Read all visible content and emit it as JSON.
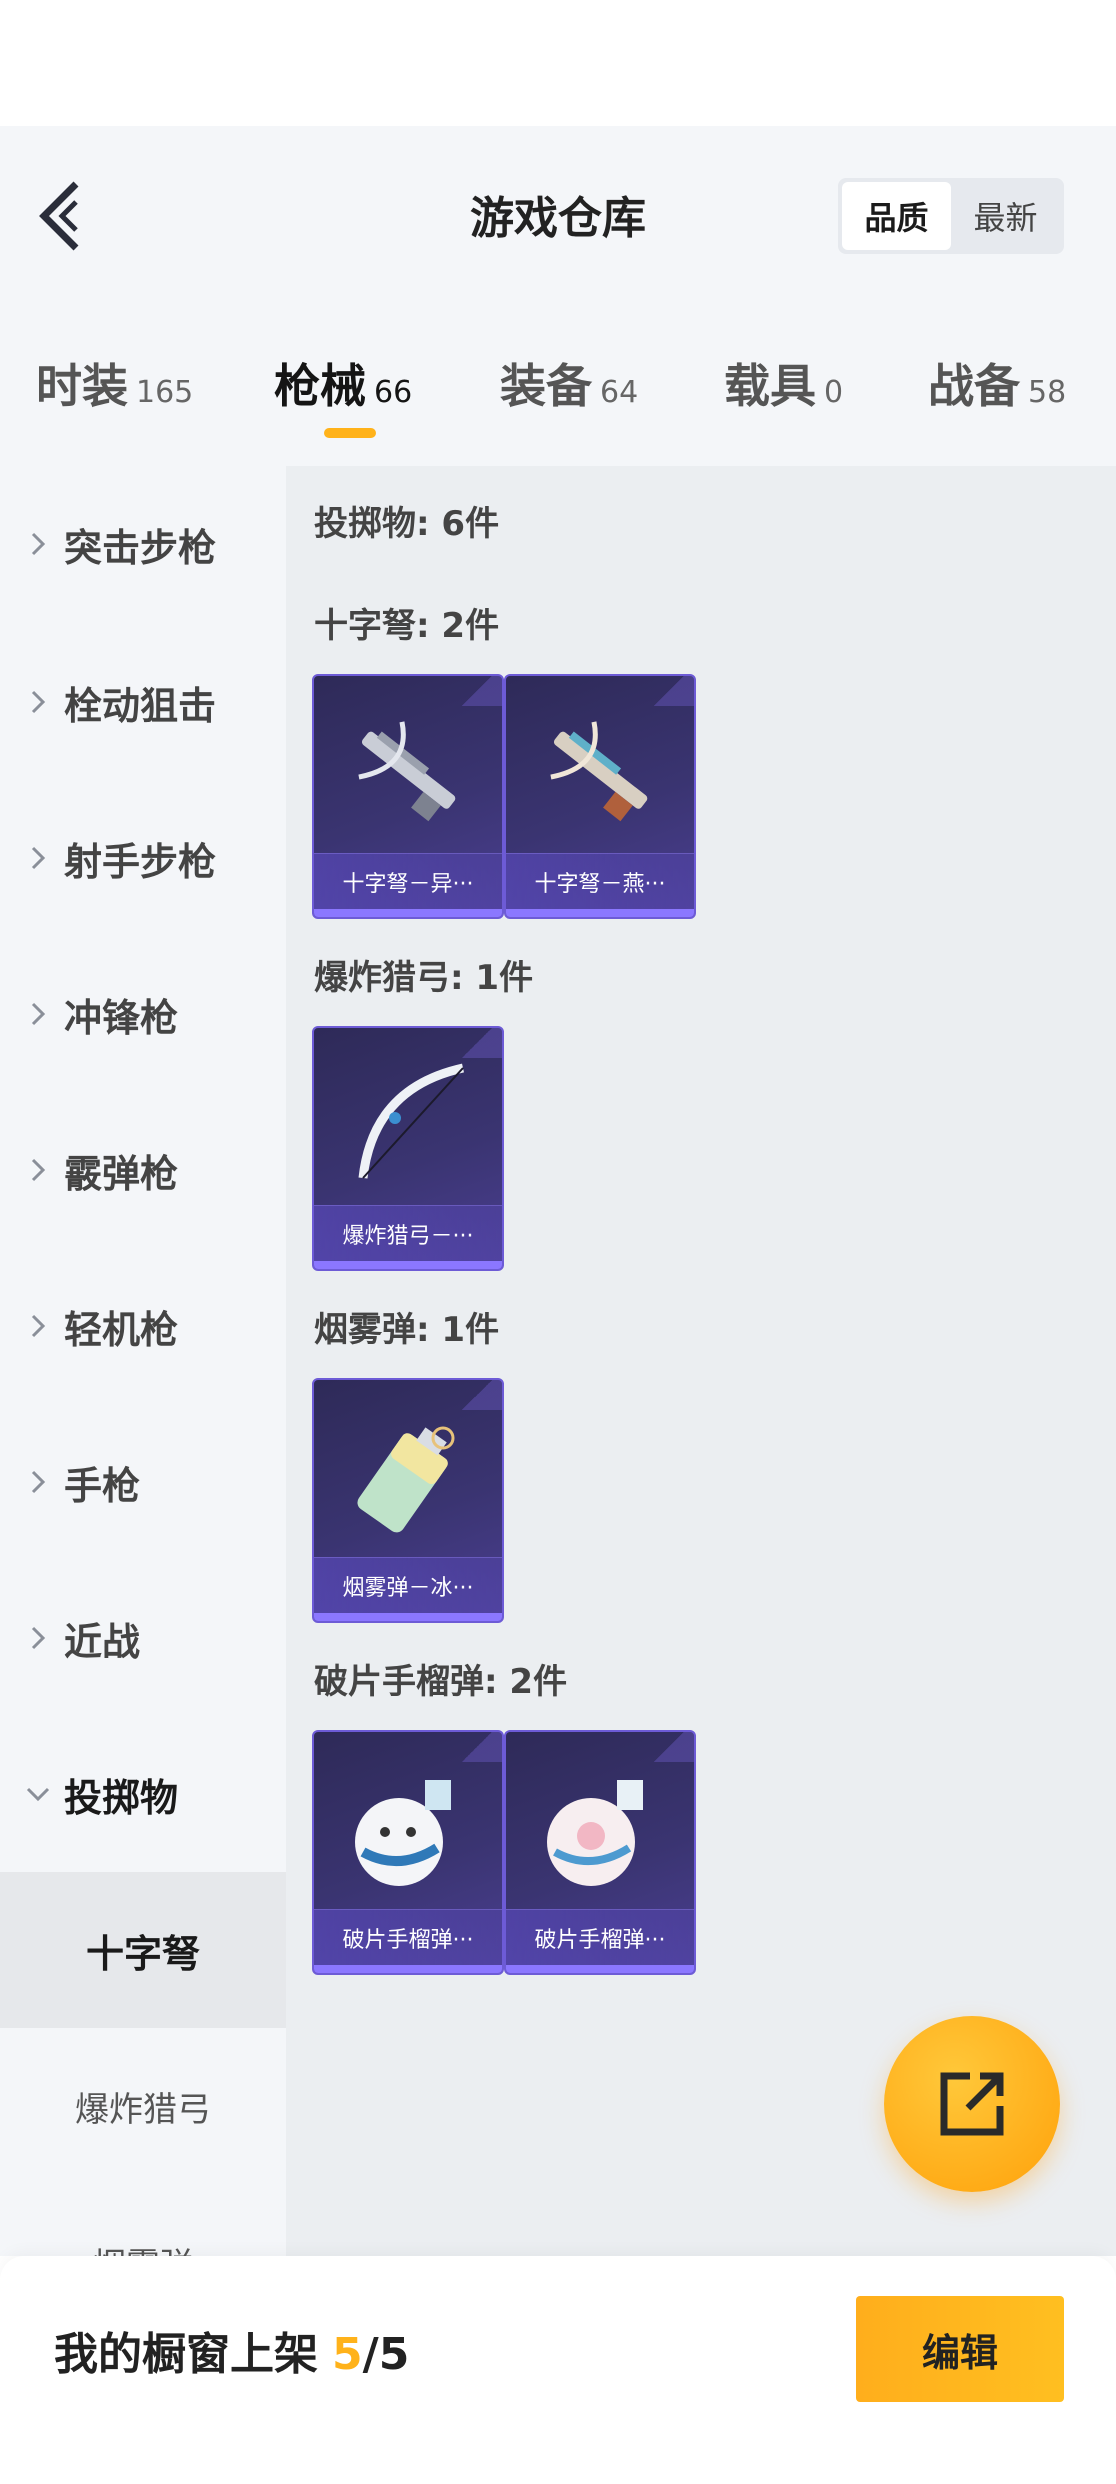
{
  "header": {
    "title": "游戏仓库",
    "sort": {
      "options": [
        "品质",
        "最新"
      ],
      "selected": "品质"
    }
  },
  "tabs": [
    {
      "label": "时装",
      "count": "165"
    },
    {
      "label": "枪械",
      "count": "66",
      "active": true
    },
    {
      "label": "装备",
      "count": "64"
    },
    {
      "label": "载具",
      "count": "0"
    },
    {
      "label": "战备",
      "count": "58"
    }
  ],
  "sidebar": {
    "categories": [
      {
        "label": "突击步枪"
      },
      {
        "label": "栓动狙击"
      },
      {
        "label": "射手步枪"
      },
      {
        "label": "冲锋枪"
      },
      {
        "label": "霰弹枪"
      },
      {
        "label": "轻机枪"
      },
      {
        "label": "手枪"
      },
      {
        "label": "近战"
      },
      {
        "label": "投掷物",
        "expanded": true
      }
    ],
    "subcategories": [
      {
        "label": "十字弩",
        "active": true
      },
      {
        "label": "爆炸猎弓"
      },
      {
        "label": "烟雾弹"
      }
    ]
  },
  "content": {
    "summary": "投掷物: 6件",
    "groups": [
      {
        "title": "十字弩: 2件",
        "items": [
          "十字弩－异···",
          "十字弩－燕···"
        ]
      },
      {
        "title": "爆炸猎弓: 1件",
        "items": [
          "爆炸猎弓－···"
        ]
      },
      {
        "title": "烟雾弹: 1件",
        "items": [
          "烟雾弹－冰···"
        ]
      },
      {
        "title": "破片手榴弹: 2件",
        "items": [
          "破片手榴弹···",
          "破片手榴弹···"
        ]
      }
    ]
  },
  "footer": {
    "shelf_label": "我的橱窗上架",
    "shelf_current": "5",
    "shelf_sep": "/",
    "shelf_total": "5",
    "edit_label": "编辑"
  },
  "colors": {
    "accent": "#ffb21a",
    "card": "#3a3471",
    "card_border": "#6d5bd6"
  }
}
